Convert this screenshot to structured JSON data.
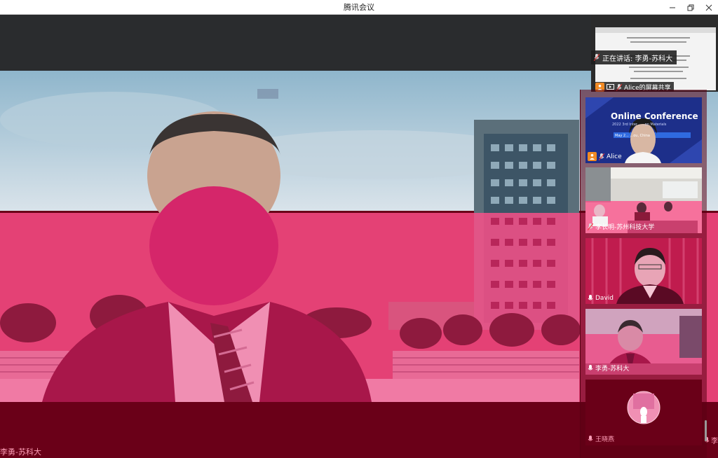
{
  "app": {
    "title": "腾讯会议"
  },
  "window_controls": [
    "minimize-icon",
    "restore-icon",
    "close-icon"
  ],
  "main_speaker": {
    "name": "李勇-苏科大",
    "right_edge_name": "李"
  },
  "share": {
    "speaking_label": "正在讲话: 李勇-苏科大",
    "share_label": "Alice的屏幕共享"
  },
  "participants": [
    {
      "name": "Alice",
      "banner_title": "Online Conference",
      "banner_sub": "2022 3rd Inter...  ...on Materials",
      "banner_date": "May 2...  ...ou, China",
      "host": true
    },
    {
      "name": "李长明-苏州科技大学",
      "host": false
    },
    {
      "name": "David",
      "host": false
    },
    {
      "name": "李勇-苏科大",
      "host": false
    },
    {
      "name": "王晓燕",
      "host": false
    }
  ],
  "colors": {
    "overlay_pink": "#ff4f8a",
    "dark_red": "#6a0018",
    "host_orange": "#f08a24",
    "banner_blue": "#1d2f8a"
  }
}
